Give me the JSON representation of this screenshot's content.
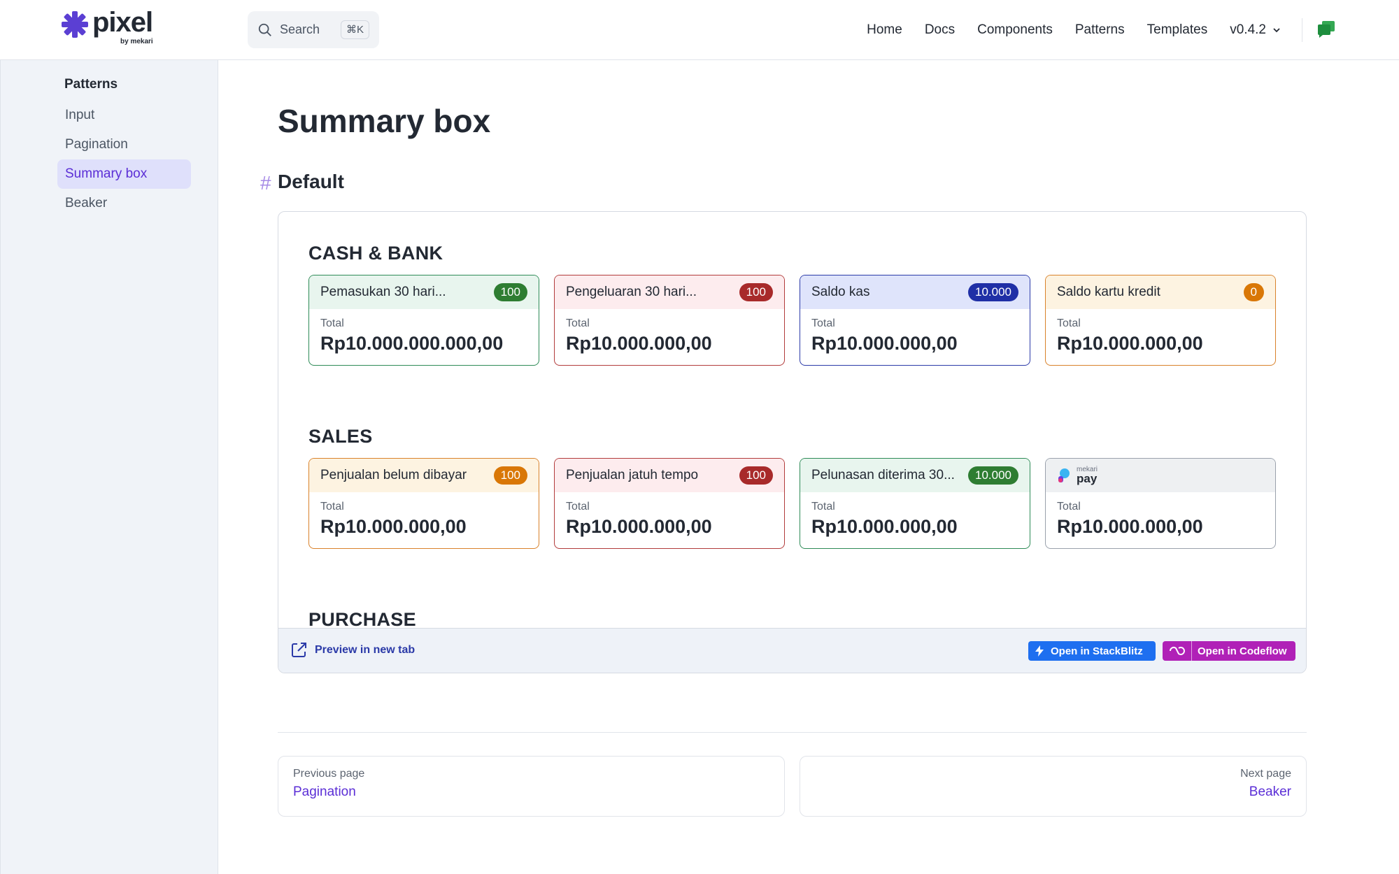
{
  "header": {
    "logo_text": "pixel",
    "logo_sub": "by mekari",
    "search_label": "Search",
    "search_shortcut": "⌘K",
    "nav": [
      "Home",
      "Docs",
      "Components",
      "Patterns",
      "Templates"
    ],
    "version": "v0.4.2"
  },
  "sidebar": {
    "heading": "Patterns",
    "items": [
      "Input",
      "Pagination",
      "Summary box",
      "Beaker"
    ],
    "active": "Summary box"
  },
  "main": {
    "title": "Summary box",
    "section_hash": "#",
    "section_title": "Default",
    "groups": [
      {
        "title": "CASH & BANK",
        "cards": [
          {
            "title": "Pemasukan 30 hari...",
            "badge": "100",
            "label": "Total",
            "value": "Rp10.000.000.000,00",
            "variant": "green"
          },
          {
            "title": "Pengeluaran 30 hari...",
            "badge": "100",
            "label": "Total",
            "value": "Rp10.000.000,00",
            "variant": "red"
          },
          {
            "title": "Saldo kas",
            "badge": "10.000",
            "label": "Total",
            "value": "Rp10.000.000,00",
            "variant": "blue"
          },
          {
            "title": "Saldo kartu kredit",
            "badge": "0",
            "label": "Total",
            "value": "Rp10.000.000,00",
            "variant": "orange"
          }
        ]
      },
      {
        "title": "SALES",
        "cards": [
          {
            "title": "Penjualan belum dibayar",
            "badge": "100",
            "label": "Total",
            "value": "Rp10.000.000,00",
            "variant": "orange"
          },
          {
            "title": "Penjualan jatuh tempo",
            "badge": "100",
            "label": "Total",
            "value": "Rp10.000.000,00",
            "variant": "red"
          },
          {
            "title": "Pelunasan diterima 30...",
            "badge": "10.000",
            "label": "Total",
            "value": "Rp10.000.000,00",
            "variant": "green"
          },
          {
            "title": "",
            "badge": "",
            "label": "Total",
            "value": "Rp10.000.000,00",
            "variant": "grey",
            "logo_sub": "mekari",
            "logo_main": "pay"
          }
        ]
      },
      {
        "title": "PURCHASE",
        "cards": []
      }
    ],
    "preview_tab": "Preview in new tab",
    "stackblitz": "Open in StackBlitz",
    "codeflow": "Open in Codeflow"
  },
  "pager": {
    "prev_label": "Previous page",
    "prev_link": "Pagination",
    "next_label": "Next page",
    "next_link": "Beaker"
  },
  "colors": {
    "accent": "#5b2ed6",
    "green": "#2e7d32",
    "red": "#a82a2a",
    "blue": "#1f2fa6",
    "orange": "#d97706"
  }
}
